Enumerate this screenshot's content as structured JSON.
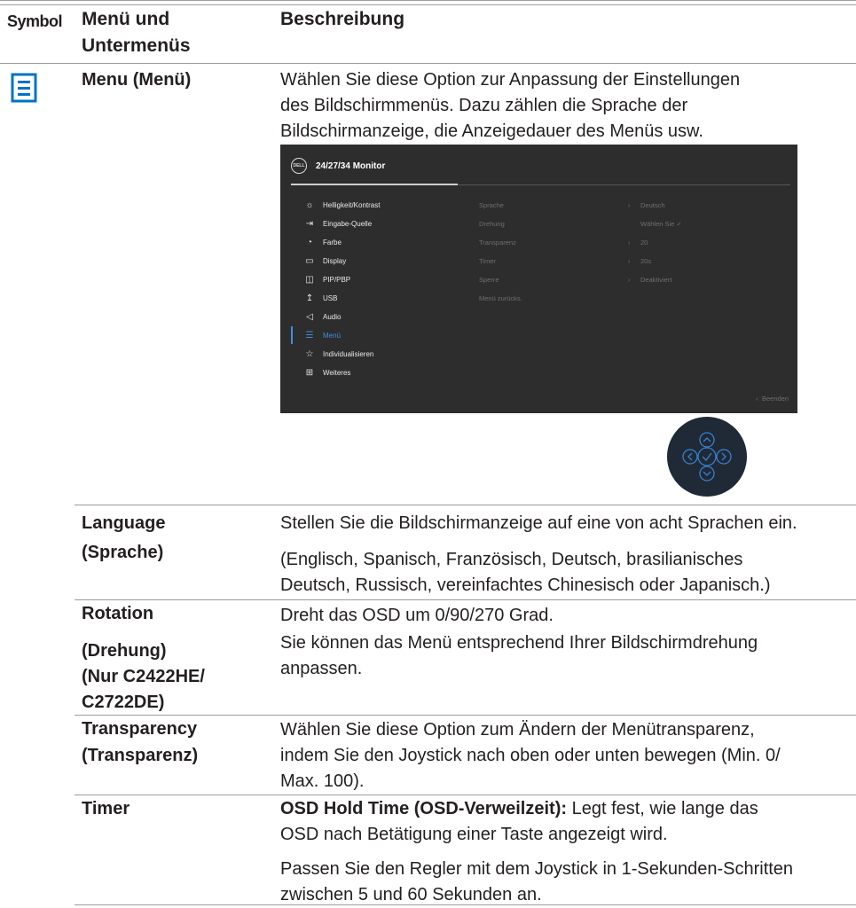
{
  "header": {
    "symbol": "Symbol",
    "menu_line1": "Menü und",
    "menu_line2": "Untermenüs",
    "description": "Beschreibung"
  },
  "menu_row": {
    "name": "Menu (Menü)",
    "desc_lines": [
      "Wählen Sie diese Option zur Anpassung der Einstellungen",
      "des Bildschirmmenüs. Dazu zählen die Sprache der",
      "Bildschirmanzeige, die Anzeigedauer des Menüs usw."
    ],
    "icon": "menu-list-icon",
    "icon_color": "#0073c6"
  },
  "osd": {
    "logo": "DELL",
    "title": "24/27/34 Monitor",
    "menu_items": [
      {
        "icon": "brightness-icon",
        "label": "Helligkeit/Kontrast"
      },
      {
        "icon": "input-source-icon",
        "label": "Eingabe-Quelle"
      },
      {
        "icon": "color-icon",
        "label": "Farbe"
      },
      {
        "icon": "display-icon",
        "label": "Display"
      },
      {
        "icon": "pip-pbp-icon",
        "label": "PIP/PBP"
      },
      {
        "icon": "usb-icon",
        "label": "USB"
      },
      {
        "icon": "audio-icon",
        "label": "Audio"
      },
      {
        "icon": "menu-icon",
        "label": "Menü"
      },
      {
        "icon": "star-icon",
        "label": "Individualisieren"
      },
      {
        "icon": "others-icon",
        "label": "Weiteres"
      }
    ],
    "selected": "Menü",
    "submenu": [
      "Sprache",
      "Drehung",
      "Transparenz",
      "Timer",
      "Sperre",
      "Menü zurücks."
    ],
    "values": [
      "Deutsch",
      "Wählen Sie ✓",
      "20",
      "20s",
      "Deaktiviert"
    ],
    "exit": "Beenden",
    "accent": "#3f8ee0"
  },
  "joystick": {
    "icons": [
      "joystick-up-icon",
      "joystick-left-icon",
      "joystick-ok-icon",
      "joystick-right-icon",
      "joystick-down-icon"
    ],
    "color": "#1f2a36",
    "accent": "#3a7fcf"
  },
  "rows": [
    {
      "name_lines": [
        "Language",
        "(Sprache)"
      ],
      "desc_lines": [
        "Stellen Sie die Bildschirmanzeige auf eine von acht Sprachen ein.",
        "(Englisch, Spanisch, Französisch, Deutsch, brasilianisches",
        "Deutsch, Russisch, vereinfachtes Chinesisch oder Japanisch.)"
      ]
    },
    {
      "name_lines": [
        "Rotation",
        "(Drehung)",
        "(Nur C2422HE/",
        "C2722DE)"
      ],
      "desc_lines": [
        "Dreht das OSD um 0/90/270 Grad.",
        "Sie können das Menü entsprechend Ihrer Bildschirmdrehung",
        "anpassen."
      ]
    },
    {
      "name_lines": [
        "Transparency",
        "(Transparenz)"
      ],
      "desc_lines": [
        "Wählen Sie diese Option zum Ändern der Menütransparenz,",
        "indem Sie den Joystick nach oben oder unten bewegen (Min. 0/",
        "Max. 100)."
      ]
    },
    {
      "name_lines": [
        "Timer"
      ],
      "desc_bold": "OSD Hold Time (OSD-Verweilzeit):",
      "desc_rest": " Legt fest, wie lange das",
      "desc_lines": [
        "OSD nach Betätigung einer Taste angezeigt wird.",
        "Passen Sie den Regler mit dem Joystick in 1-Sekunden-Schritten",
        "zwischen 5 und 60 Sekunden an."
      ]
    }
  ]
}
